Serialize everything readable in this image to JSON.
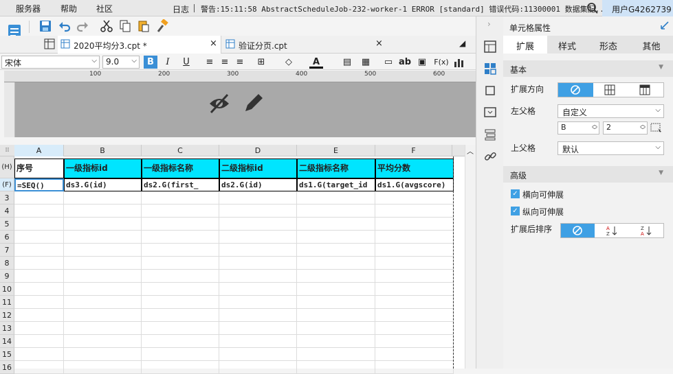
{
  "menu": {
    "items": [
      "服务器",
      "帮助",
      "社区"
    ],
    "log": "日志",
    "warning": "警告:15:11:58 AbstractScheduleJob-232-worker-1 ERROR [standard] 错误代码:11300001 数据集配...",
    "user": "用户G4262739"
  },
  "tabs": [
    {
      "label": "2020平均分3.cpt *",
      "active": true
    },
    {
      "label": "验证分页.cpt",
      "active": false
    }
  ],
  "format": {
    "font": "宋体",
    "size": "9.0",
    "bold": "B",
    "italic": "I",
    "underline": "U",
    "ab": "ab",
    "fx": "F(x)"
  },
  "ruler": {
    "ticks": [
      "100",
      "200",
      "300",
      "400",
      "500",
      "600"
    ]
  },
  "columns": [
    "A",
    "B",
    "C",
    "D",
    "E",
    "F"
  ],
  "rows": {
    "header_label": "(H)",
    "formula_label": "(F)",
    "numbers": [
      "3",
      "4",
      "5",
      "6",
      "7",
      "8",
      "9",
      "10",
      "11",
      "12",
      "13",
      "14",
      "15",
      "16"
    ]
  },
  "header_cells": [
    "序号",
    "一级指标id",
    "一级指标名称",
    "二级指标id",
    "二级指标名称",
    "平均分数"
  ],
  "formula_cells": [
    "=SEQ()",
    "ds3.G(id)",
    "ds2.G(first_",
    "ds2.G(id)",
    "ds1.G(target_id",
    "ds1.G(avgscore)"
  ],
  "panel": {
    "title": "单元格属性",
    "tabs": [
      "扩展",
      "样式",
      "形态",
      "其他"
    ],
    "active_tab": "扩展",
    "basic": "基本",
    "expand_dir": "扩展方向",
    "left_parent": "左父格",
    "left_parent_value": "自定义",
    "left_col": "B",
    "left_row": "2",
    "top_parent": "上父格",
    "top_parent_value": "默认",
    "advanced": "高级",
    "h_expand": "横向可伸展",
    "v_expand": "纵向可伸展",
    "sort_after": "扩展后排序"
  },
  "colors": {
    "accent": "#3fa0e4",
    "header_fill": "#00e5ff"
  }
}
